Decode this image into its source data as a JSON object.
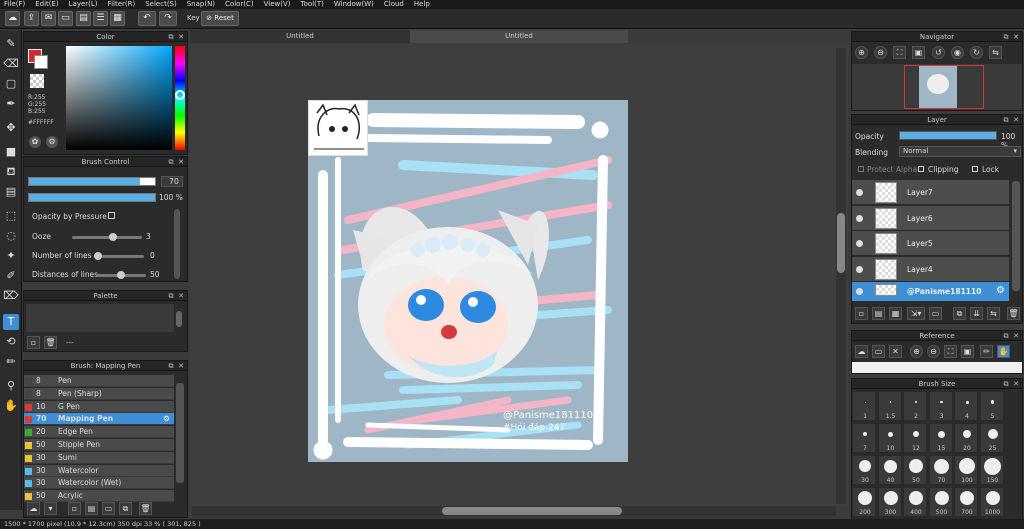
{
  "menu": [
    "File(F)",
    "Edit(E)",
    "Layer(L)",
    "Filter(R)",
    "Select(S)",
    "Snap(N)",
    "Color(C)",
    "View(V)",
    "Tool(T)",
    "Window(W)",
    "Cloud",
    "Help"
  ],
  "toolbar": {
    "key_label": "Key",
    "reset_label": "Reset"
  },
  "tabs": [
    "Untitled",
    "Untitled"
  ],
  "color_panel": {
    "title": "Color",
    "r": "R:255",
    "g": "G:255",
    "b": "B:255",
    "hex": "#FFFFFF",
    "primary": "#d42a2a",
    "secondary": "#ffffff"
  },
  "brush_control": {
    "title": "Brush Control",
    "size_value": "70",
    "size_fill": 0.88,
    "opacity_value": "100 %",
    "opacity_fill": 1.0,
    "opacity_pressure_label": "Opacity by Pressure",
    "ooze_label": "Ooze",
    "ooze_value": "3",
    "ooze_level": 0.6,
    "lines_label": "Number of lines",
    "lines_value": "0",
    "lines_level": 0.0,
    "dist_label": "Distances of lines",
    "dist_value": "50",
    "dist_level": 0.5
  },
  "palette": {
    "title": "Palette",
    "extra": "---"
  },
  "brush_list": {
    "title": "Brush: Mapping Pen",
    "items": [
      {
        "size": "8",
        "name": "Pen",
        "color": "#444444"
      },
      {
        "size": "8",
        "name": "Pen (Sharp)",
        "color": "#444444"
      },
      {
        "size": "10",
        "name": "G Pen",
        "color": "#d63a3a"
      },
      {
        "size": "70",
        "name": "Mapping Pen",
        "color": "#d63a3a"
      },
      {
        "size": "20",
        "name": "Edge Pen",
        "color": "#3aaa3a"
      },
      {
        "size": "50",
        "name": "Stipple Pen",
        "color": "#e8c33a"
      },
      {
        "size": "30",
        "name": "Sumi",
        "color": "#e8c33a"
      },
      {
        "size": "30",
        "name": "Watercolor",
        "color": "#5ab8e8"
      },
      {
        "size": "30",
        "name": "Watercolor (Wet)",
        "color": "#5ab8e8"
      },
      {
        "size": "50",
        "name": "Acrylic",
        "color": "#e8c33a"
      }
    ]
  },
  "canvas_art": {
    "watermark_line1": "@Panisme181110",
    "watermark_line2": "#Hỏi đáp 247",
    "bg_color": "#9fb6c6"
  },
  "navigator": {
    "title": "Navigator"
  },
  "layer_panel": {
    "title": "Layer",
    "opacity_label": "Opacity",
    "opacity_value": "100 %",
    "opacity_fill": 1.0,
    "blending_label": "Blending",
    "blending_value": "Normal",
    "protect_alpha": "Protect Alpha",
    "clipping": "Clipping",
    "lock": "Lock",
    "layers": [
      "Layer7",
      "Layer6",
      "Layer5",
      "Layer4",
      "@Panisme181110"
    ]
  },
  "reference": {
    "title": "Reference"
  },
  "brush_size": {
    "title": "Brush Size",
    "sizes": [
      "1",
      "1.5",
      "2",
      "3",
      "4",
      "5",
      "7",
      "10",
      "12",
      "15",
      "20",
      "25",
      "30",
      "40",
      "50",
      "70",
      "100",
      "150",
      "200",
      "300",
      "400",
      "500",
      "700",
      "1000"
    ]
  },
  "status": "1500 * 1700 pixel  (10.9 * 12.3cm)  350 dpi  33 %  ( 301, 825 )"
}
